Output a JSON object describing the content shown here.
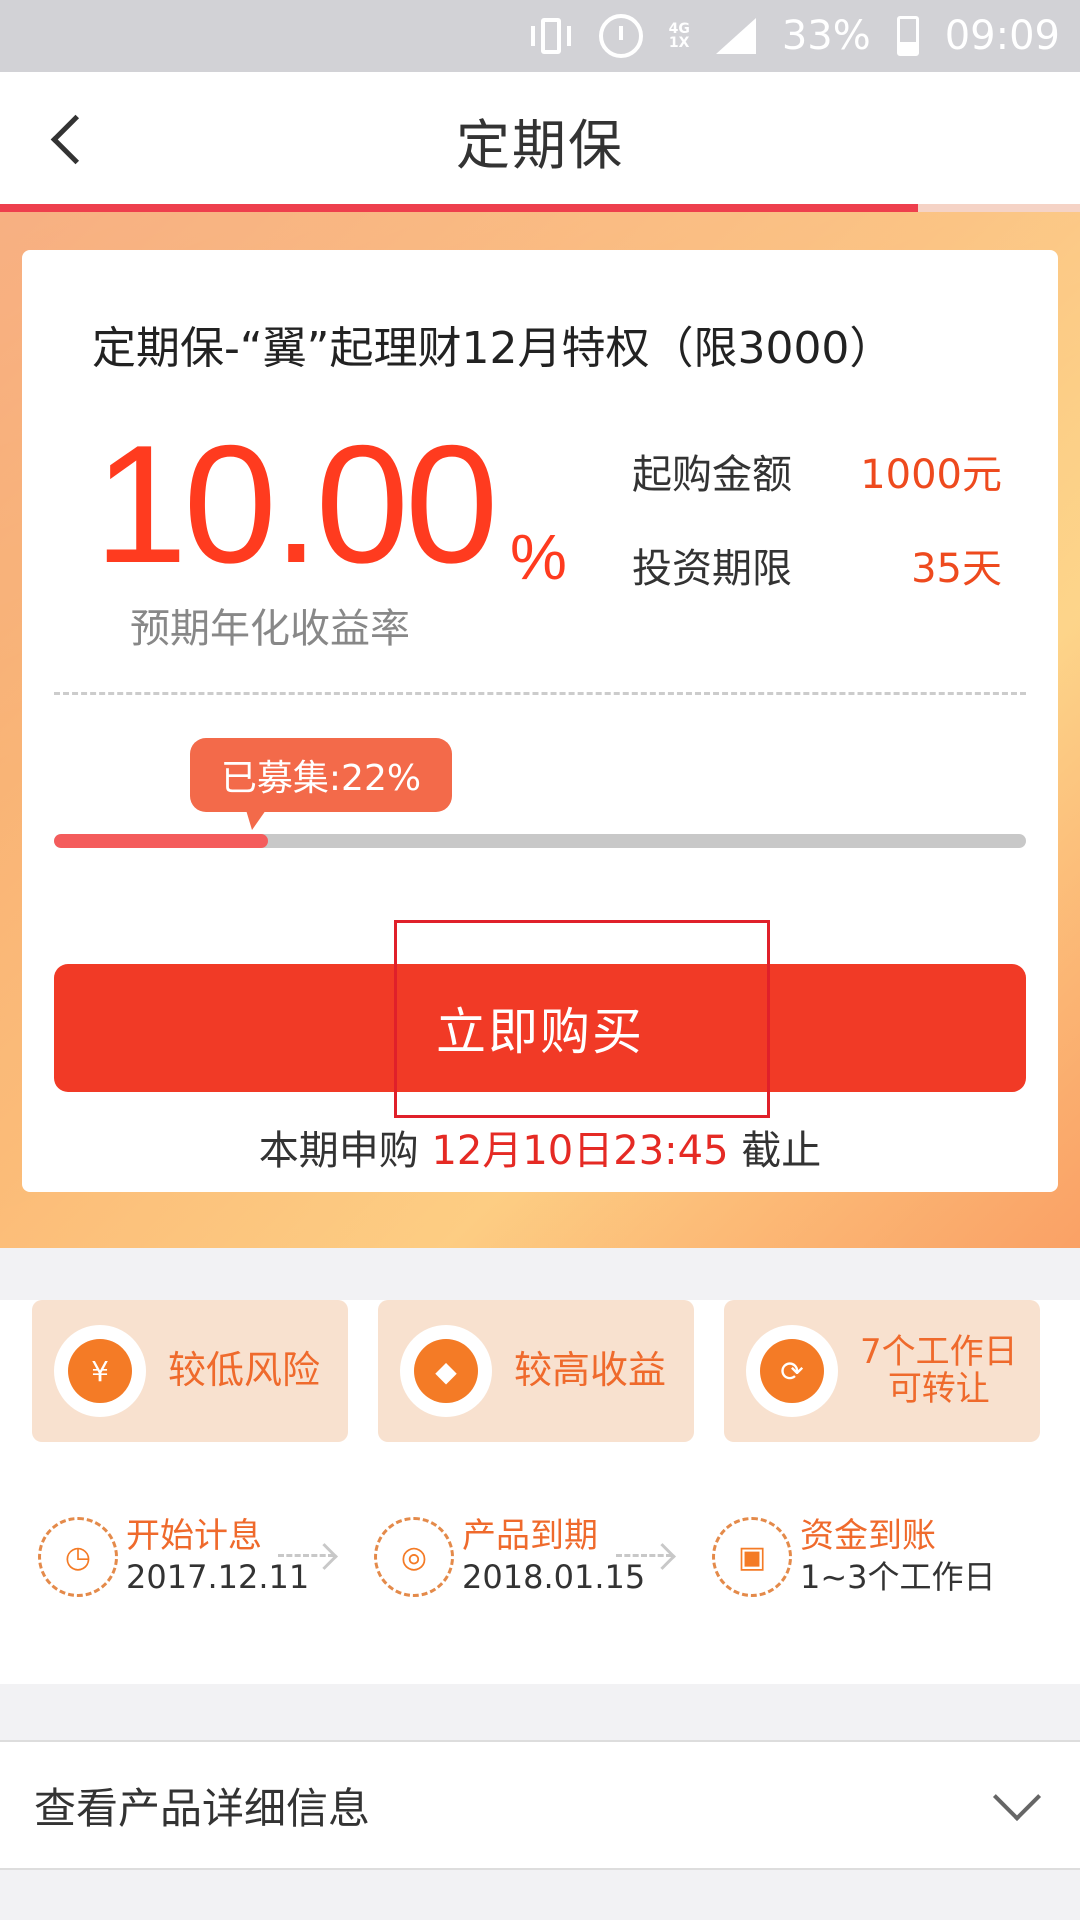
{
  "status_bar": {
    "network_top": "4G",
    "network_bottom": "1X",
    "battery": "33%",
    "time": "09:09",
    "icons": [
      "vibrate-icon",
      "alarm-icon",
      "signal-icon",
      "battery-icon"
    ]
  },
  "nav": {
    "title": "定期保",
    "back_icon": "chevron-left-icon",
    "load_progress": 0.85
  },
  "product": {
    "title": "定期保-“翼”起理财12月特权（限3000）",
    "rate_value": "10.00",
    "rate_unit": "%",
    "rate_label": "预期年化收益率",
    "min_amount_label": "起购金额",
    "min_amount_value": "1000元",
    "term_label": "投资期限",
    "term_value": "35天",
    "raised_label": "已募集:22%",
    "raised_fraction": 0.22,
    "buy_button": "立即购买",
    "deadline_prefix": "本期申购",
    "deadline_time": "12月10日23:45",
    "deadline_suffix": "截止"
  },
  "features": [
    {
      "label": "较低风险",
      "icon": "yen-coin-icon",
      "glyph": "¥"
    },
    {
      "label": "较高收益",
      "icon": "diamond-icon",
      "glyph": "◆"
    },
    {
      "label_line1": "7个工作日",
      "label_line2": "可转让",
      "icon": "exchange-icon",
      "glyph": "⟳"
    }
  ],
  "timeline": [
    {
      "title": "开始计息",
      "value": "2017.12.11",
      "icon": "alarm-clock-icon",
      "glyph": "◷"
    },
    {
      "title": "产品到期",
      "value": "2018.01.15",
      "icon": "coins-icon",
      "glyph": "◎"
    },
    {
      "title": "资金到账",
      "value": "1~3个工作日",
      "icon": "wallet-icon",
      "glyph": "▣"
    }
  ],
  "details": {
    "label": "查看产品详细信息",
    "icon": "chevron-down-icon"
  },
  "colors": {
    "accent": "#f13a26",
    "rate": "#ff3b1f",
    "feature_text": "#ef6a2c",
    "feature_bg": "#f8e1cf"
  }
}
